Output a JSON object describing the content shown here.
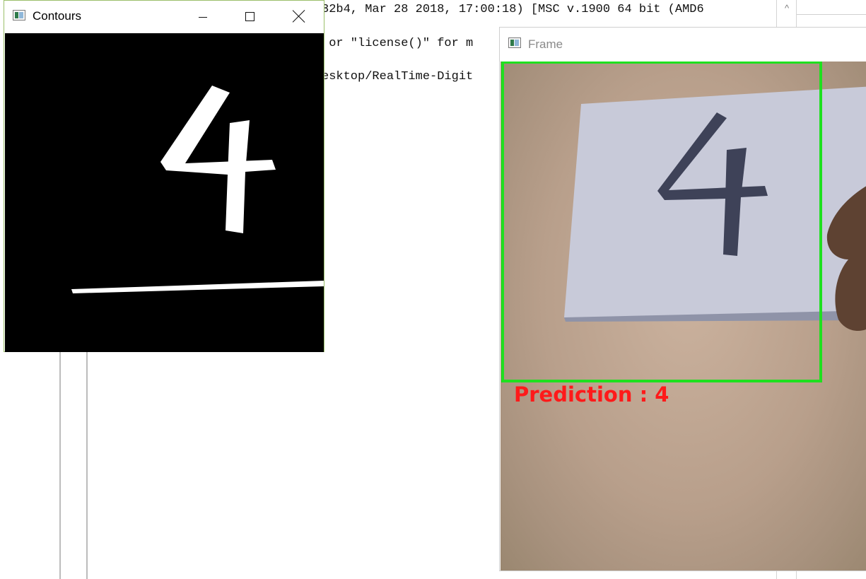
{
  "console": {
    "lines": [
      "32b4, Mar 28 2018, 17:00:18) [MSC v.1900 64 bit (AMD6",
      " or \"license()\" for m",
      "esktop/RealTime-Digit"
    ],
    "scroll_up_arrow": "^"
  },
  "contours_window": {
    "title": "Contours",
    "buttons": {
      "minimize": "",
      "maximize": "",
      "close": ""
    }
  },
  "frame_window": {
    "title": "Frame",
    "prediction_text": "Prediction : 4",
    "colors": {
      "roi_box": "#1fe01f",
      "prediction": "#ff1a1a"
    }
  },
  "digit_shown": "4",
  "icons": [
    "app-icon",
    "minimize-icon",
    "maximize-icon",
    "close-icon",
    "scroll-up-arrow-icon"
  ]
}
